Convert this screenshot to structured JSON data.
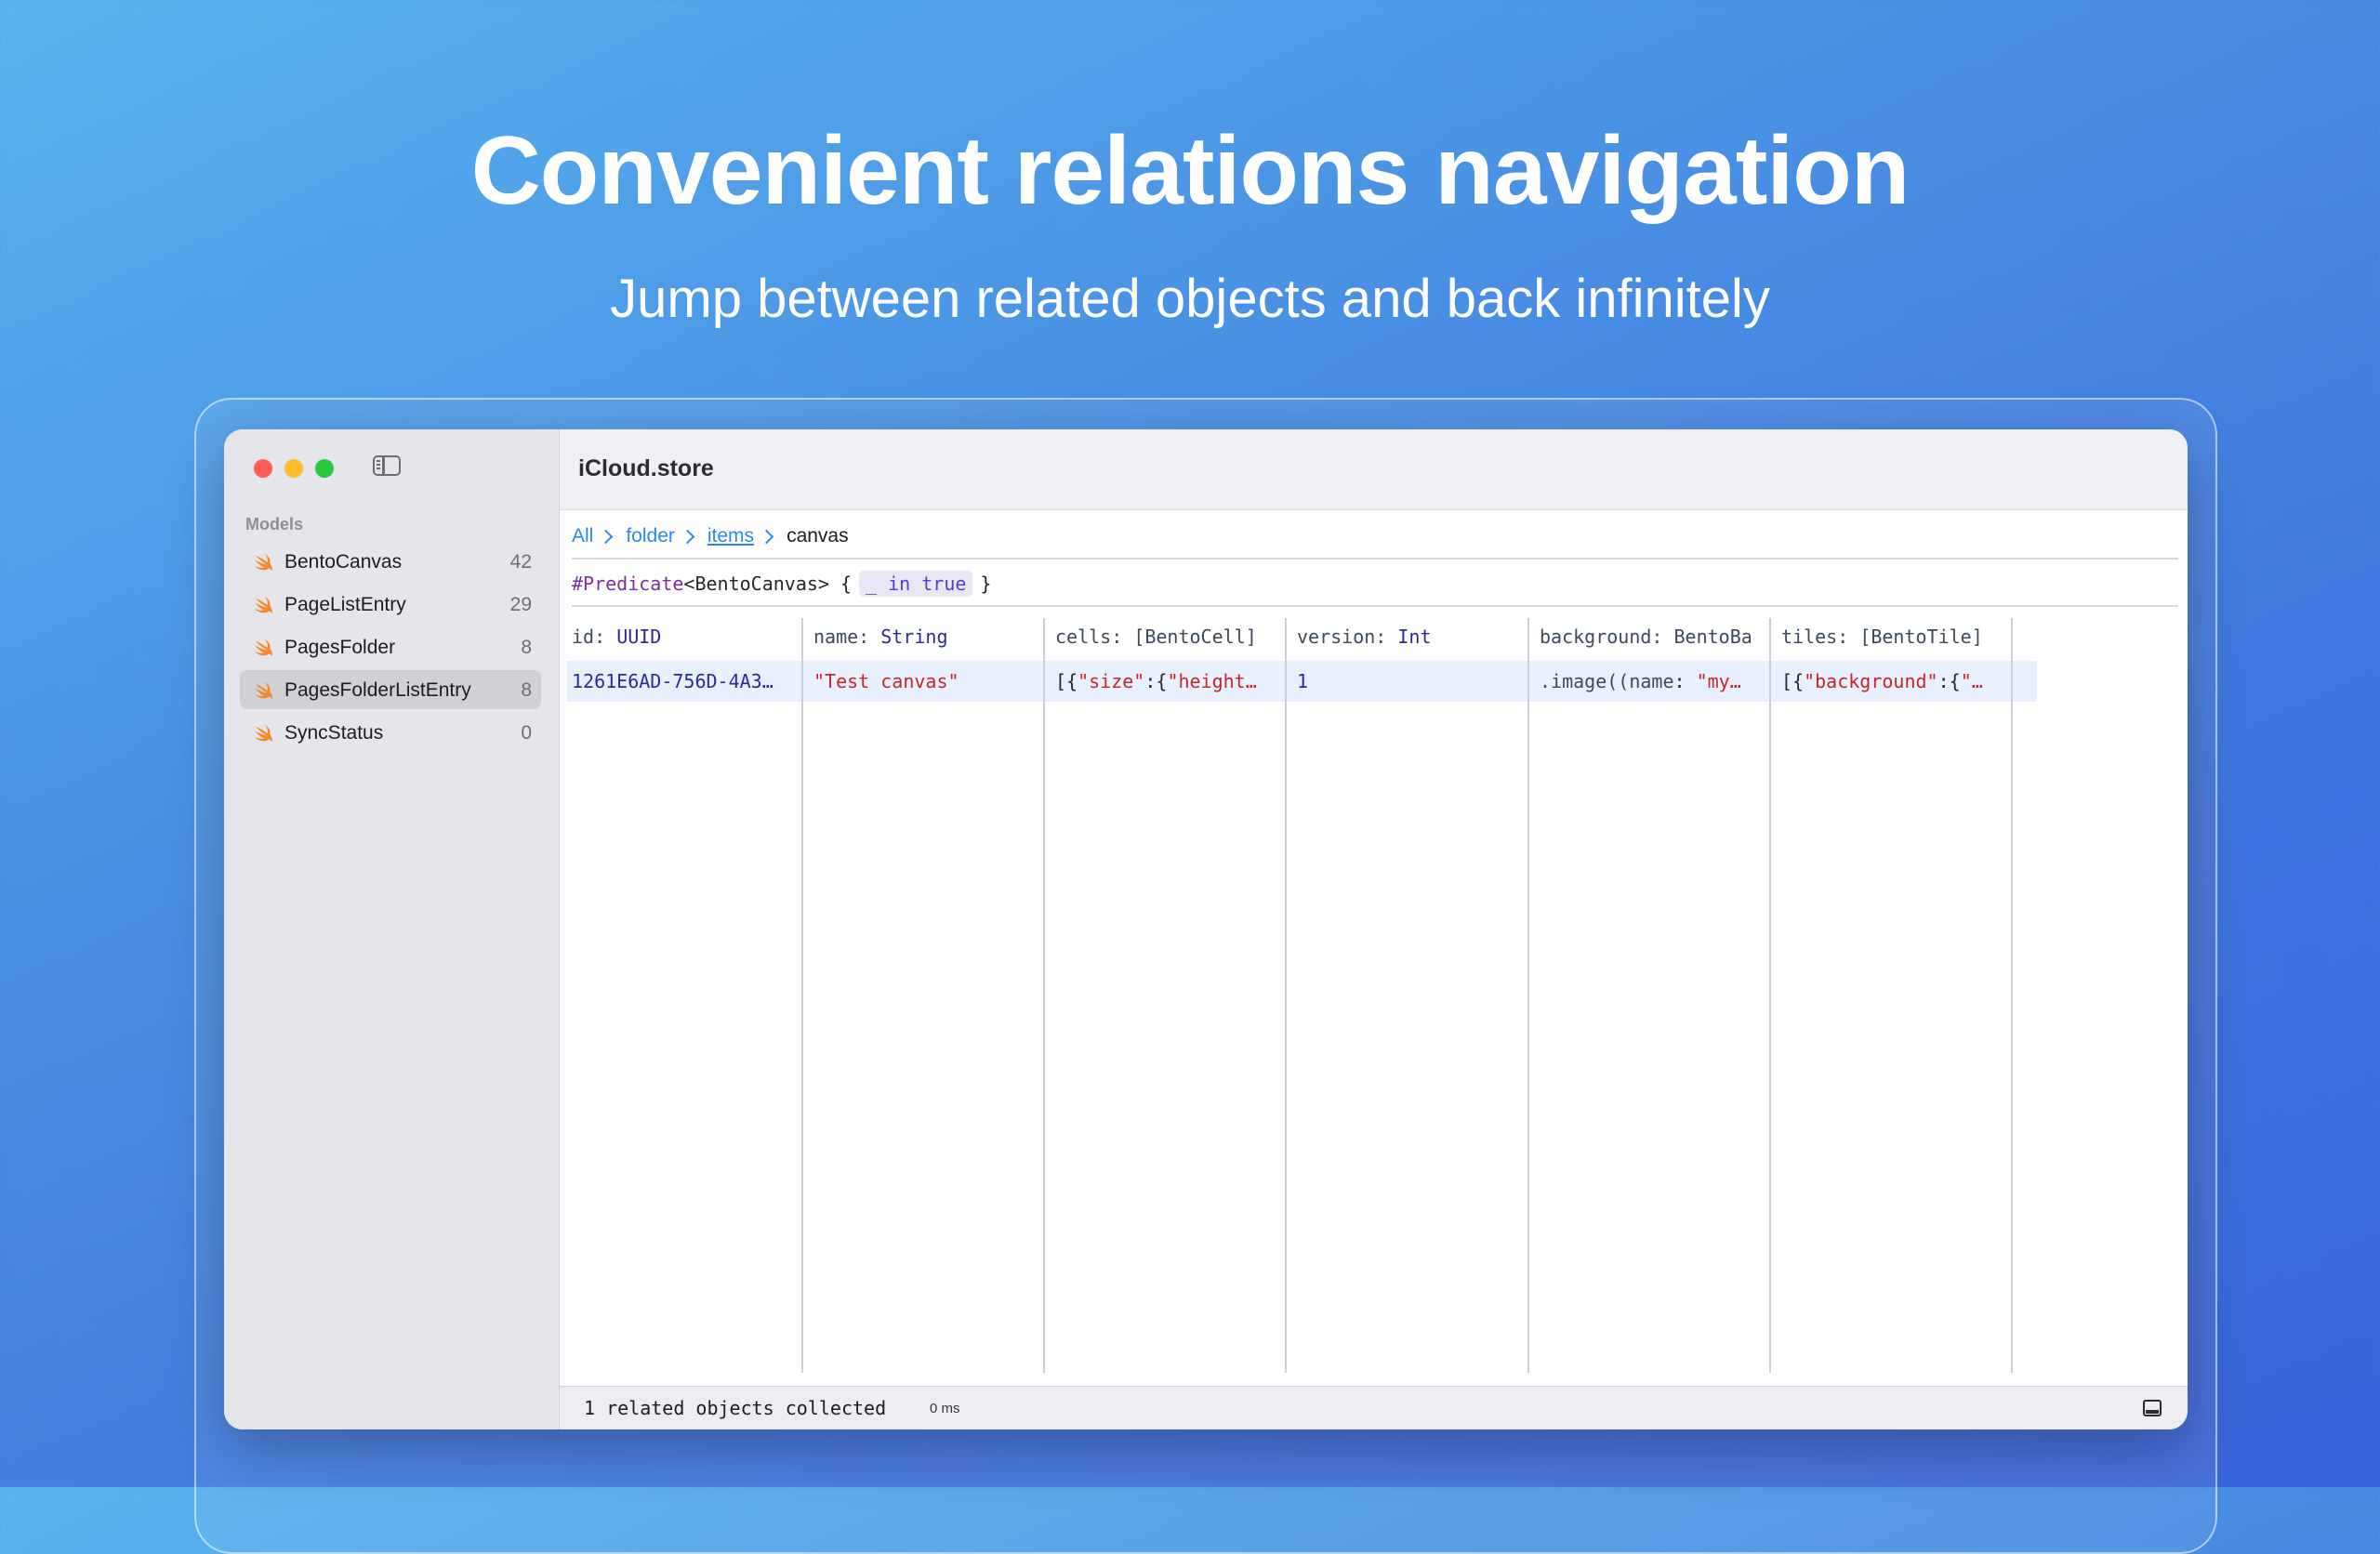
{
  "hero": {
    "title": "Convenient relations navigation",
    "subtitle": "Jump between related objects and back infinitely"
  },
  "window": {
    "title": "iCloud.store"
  },
  "sidebar": {
    "section_header": "Models",
    "items": [
      {
        "label": "BentoCanvas",
        "count": "42",
        "icon": "swift-icon"
      },
      {
        "label": "PageListEntry",
        "count": "29",
        "icon": "swift-icon"
      },
      {
        "label": "PagesFolder",
        "count": "8",
        "icon": "swift-icon"
      },
      {
        "label": "PagesFolderListEntry",
        "count": "8",
        "icon": "swift-icon",
        "selected": true
      },
      {
        "label": "SyncStatus",
        "count": "0",
        "icon": "swift-icon"
      }
    ]
  },
  "breadcrumb": {
    "items": [
      "All",
      "folder",
      "items",
      "canvas"
    ]
  },
  "predicate": {
    "keyword": "#Predicate",
    "generic": "<BentoCanvas> {",
    "token": "_ in true",
    "close": "}"
  },
  "table": {
    "columns": [
      {
        "name": "id",
        "type": "UUID"
      },
      {
        "name": "name",
        "type": "String"
      },
      {
        "name": "cells",
        "type": "[BentoCell]"
      },
      {
        "name": "version",
        "type": "Int"
      },
      {
        "name": "background",
        "type": "BentoBa"
      },
      {
        "name": "tiles",
        "type": "[BentoTile]"
      }
    ],
    "rows": [
      {
        "id": "1261E6AD-756D-4A3…",
        "name": "\"Test canvas\"",
        "cells": [
          "[{",
          "\"size\"",
          ":{",
          "\"height…"
        ],
        "version": "1",
        "background": [
          ".image((",
          "name",
          ": ",
          "\"my…"
        ],
        "tiles": [
          "[{",
          "\"background\"",
          ":{",
          "\"…"
        ]
      }
    ]
  },
  "status": {
    "text": "1 related objects collected",
    "duration": "0 ms"
  },
  "colors": {
    "accent": "#2f86f2",
    "string_literal": "#c4262e",
    "type_name": "#2a2a9a",
    "selection": "#e9f0fd",
    "swift_orange": "#f05138"
  }
}
